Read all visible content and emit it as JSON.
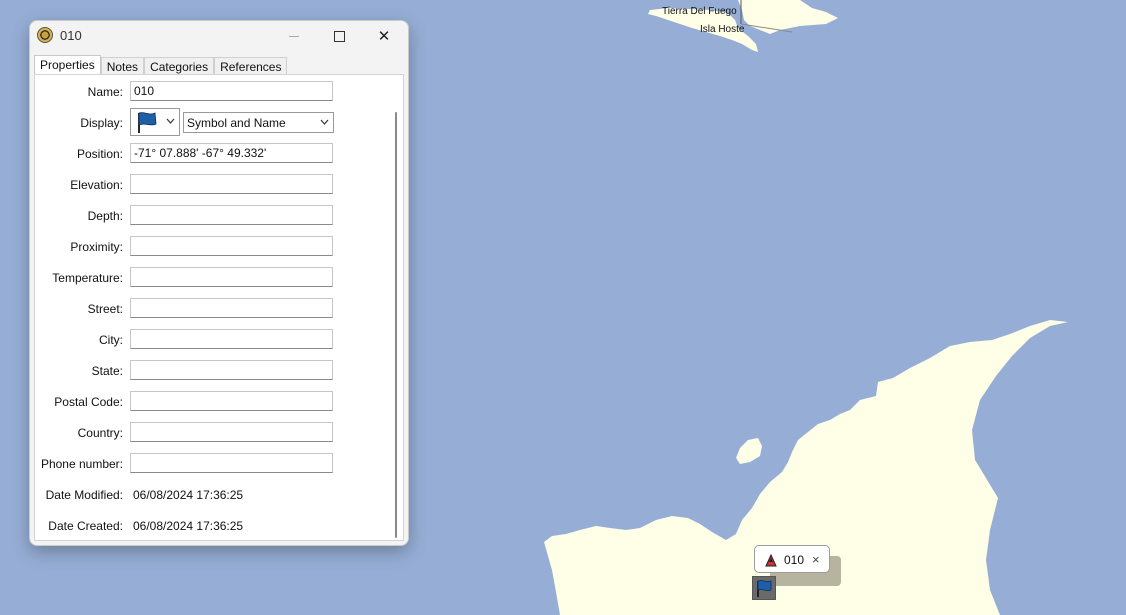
{
  "map": {
    "labels": {
      "tierra_del_fuego": "Tierra Del Fuego",
      "isla_hoste": "Isla Hoste"
    },
    "popup": {
      "label": "010",
      "close": "×"
    },
    "colors": {
      "water": "#96aed6",
      "land": "#fffee6"
    }
  },
  "window": {
    "title": "010",
    "controls": {
      "close": "✕"
    },
    "tabs": [
      "Properties",
      "Notes",
      "Categories",
      "References"
    ],
    "properties": {
      "name_label": "Name:",
      "name_value": "010",
      "display_label": "Display:",
      "display_value": "Symbol and Name",
      "symbol_icon": "blue-flag-icon",
      "position_label": "Position:",
      "position_value": "-71° 07.888' -67° 49.332'",
      "elevation_label": "Elevation:",
      "elevation_value": "",
      "depth_label": "Depth:",
      "depth_value": "",
      "proximity_label": "Proximity:",
      "proximity_value": "",
      "temperature_label": "Temperature:",
      "temperature_value": "",
      "street_label": "Street:",
      "street_value": "",
      "city_label": "City:",
      "city_value": "",
      "state_label": "State:",
      "state_value": "",
      "postal_code_label": "Postal Code:",
      "postal_code_value": "",
      "country_label": "Country:",
      "country_value": "",
      "phone_label": "Phone number:",
      "phone_value": "",
      "date_modified_label": "Date Modified:",
      "date_modified_value": "06/08/2024 17:36:25",
      "date_created_label": "Date Created:",
      "date_created_value": "06/08/2024 17:36:25"
    }
  }
}
